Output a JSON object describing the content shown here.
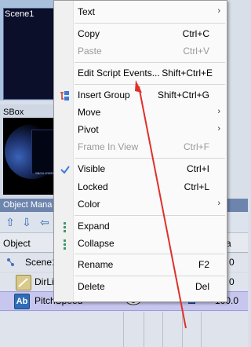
{
  "scene_panel": {
    "label": "Scene1"
  },
  "sbox_panel": {
    "label": "SBox",
    "caption": "SBOX STATE"
  },
  "object_manager": {
    "title": "Object Mana",
    "header": {
      "object": "Object",
      "right": "a"
    },
    "rows": [
      {
        "name": "Scene1",
        "value": ""
      },
      {
        "name": "DirLig",
        "value": "0"
      },
      {
        "name": "PitchSpeed",
        "value": "100.0"
      }
    ],
    "scene_value": "0"
  },
  "menu": {
    "items": [
      {
        "label": "Text",
        "shortcut": "",
        "submenu": true
      },
      {
        "label": "Copy",
        "shortcut": "Ctrl+C"
      },
      {
        "label": "Paste",
        "shortcut": "Ctrl+V",
        "disabled": true
      },
      {
        "label": "Edit Script Events...",
        "shortcut": "Shift+Ctrl+E"
      },
      {
        "label": "Insert Group",
        "shortcut": "Shift+Ctrl+G"
      },
      {
        "label": "Move",
        "shortcut": "",
        "submenu": true
      },
      {
        "label": "Pivot",
        "shortcut": "",
        "submenu": true
      },
      {
        "label": "Frame In View",
        "shortcut": "Ctrl+F",
        "disabled": true
      },
      {
        "label": "Visible",
        "shortcut": "Ctrl+I",
        "checked": true
      },
      {
        "label": "Locked",
        "shortcut": "Ctrl+L"
      },
      {
        "label": "Color",
        "shortcut": "",
        "submenu": true
      },
      {
        "label": "Expand",
        "shortcut": ""
      },
      {
        "label": "Collapse",
        "shortcut": ""
      },
      {
        "label": "Rename",
        "shortcut": "F2"
      },
      {
        "label": "Delete",
        "shortcut": "Del"
      }
    ]
  },
  "colors": {
    "accent": "#3c7bd6",
    "selection": "#c7c6ee",
    "arrow": "#e0302a"
  }
}
